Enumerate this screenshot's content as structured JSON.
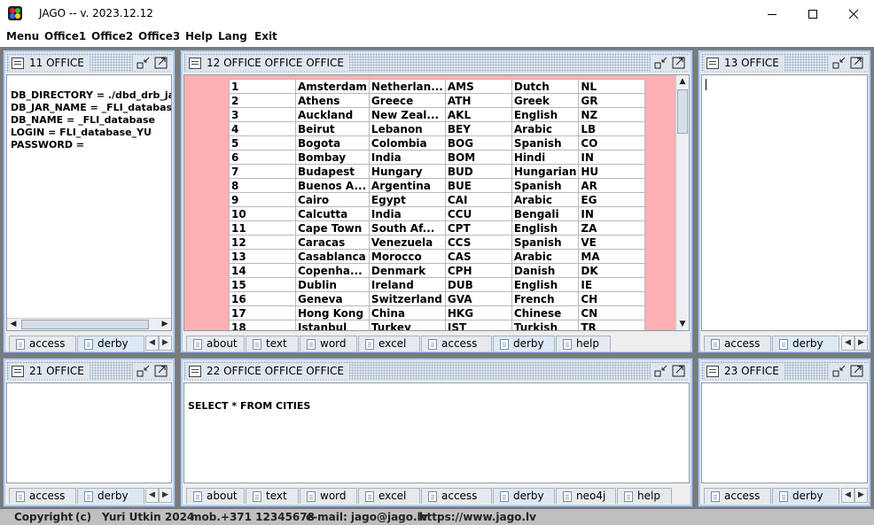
{
  "window": {
    "title": "JAGO -- v. 2023.12.12"
  },
  "menubar": [
    {
      "pre": "M",
      "u": "",
      "post": "enu",
      "label": "Menu"
    },
    {
      "label": "Office1"
    },
    {
      "label": "Office2"
    },
    {
      "label": "Office3"
    },
    {
      "label": "Help"
    },
    {
      "label": "Lang"
    },
    {
      "label": "Exit"
    }
  ],
  "frames": {
    "f11": {
      "title": "11 OFFICE",
      "text": "DB_DIRECTORY = ./dbd_drb_jar\nDB_JAR_NAME = _FLI_database\nDB_NAME = _FLI_database\nLOGIN = FLI_database_YU\nPASSWORD =",
      "tabs": [
        "access",
        "derby"
      ],
      "selected_tab": "derby"
    },
    "f12": {
      "title": "12 OFFICE OFFICE OFFICE",
      "tabs": [
        "about",
        "text",
        "word",
        "excel",
        "access",
        "derby",
        "help"
      ],
      "selected_tab": "derby",
      "rows": [
        [
          "1",
          "Amsterdam",
          "Netherlan...",
          "AMS",
          "Dutch",
          "NL"
        ],
        [
          "2",
          "Athens",
          "Greece",
          "ATH",
          "Greek",
          "GR"
        ],
        [
          "3",
          "Auckland",
          "New Zeal...",
          "AKL",
          "English",
          "NZ"
        ],
        [
          "4",
          "Beirut",
          "Lebanon",
          "BEY",
          "Arabic",
          "LB"
        ],
        [
          "5",
          "Bogota",
          "Colombia",
          "BOG",
          "Spanish",
          "CO"
        ],
        [
          "6",
          "Bombay",
          "India",
          "BOM",
          "Hindi",
          "IN"
        ],
        [
          "7",
          "Budapest",
          "Hungary",
          "BUD",
          "Hungarian",
          "HU"
        ],
        [
          "8",
          "Buenos A...",
          "Argentina",
          "BUE",
          "Spanish",
          "AR"
        ],
        [
          "9",
          "Cairo",
          "Egypt",
          "CAI",
          "Arabic",
          "EG"
        ],
        [
          "10",
          "Calcutta",
          "India",
          "CCU",
          "Bengali",
          "IN"
        ],
        [
          "11",
          "Cape Town",
          "South Af...",
          "CPT",
          "English",
          "ZA"
        ],
        [
          "12",
          "Caracas",
          "Venezuela",
          "CCS",
          "Spanish",
          "VE"
        ],
        [
          "13",
          "Casablanca",
          "Morocco",
          "CAS",
          "Arabic",
          "MA"
        ],
        [
          "14",
          "Copenha...",
          "Denmark",
          "CPH",
          "Danish",
          "DK"
        ],
        [
          "15",
          "Dublin",
          "Ireland",
          "DUB",
          "English",
          "IE"
        ],
        [
          "16",
          "Geneva",
          "Switzerland",
          "GVA",
          "French",
          "CH"
        ],
        [
          "17",
          "Hong Kong",
          "China",
          "HKG",
          "Chinese",
          "CN"
        ],
        [
          "18",
          "Istanbul",
          "Turkey",
          "IST",
          "Turkish",
          "TR"
        ]
      ]
    },
    "f13": {
      "title": "13 OFFICE",
      "tabs": [
        "access",
        "derby"
      ],
      "selected_tab": "derby"
    },
    "f21": {
      "title": "21 OFFICE",
      "tabs": [
        "access",
        "derby"
      ],
      "selected_tab": "derby"
    },
    "f22": {
      "title": "22 OFFICE OFFICE OFFICE",
      "sql": "SELECT * FROM CITIES",
      "tabs": [
        "about",
        "text",
        "word",
        "excel",
        "access",
        "derby",
        "neo4j",
        "help"
      ],
      "selected_tab": "derby"
    },
    "f23": {
      "title": "23 OFFICE",
      "tabs": [
        "access",
        "derby"
      ],
      "selected_tab": "derby"
    }
  },
  "status": {
    "copyright": "Copyright",
    "c": "(c)",
    "author": "Yuri Utkin 2024",
    "mob": "mob.+371 12345678",
    "email": "e-mail: jago@jago.lv",
    "url": "https://www.jago.lv"
  },
  "colors": {
    "desktop": "#7b7b7b",
    "grid_bg": "#ffb0b4",
    "frame_border": "#6a8bb9"
  },
  "icons": [
    "app-icon",
    "minimize-icon",
    "maximize-icon",
    "close-icon",
    "frame-menu-icon",
    "iconify-icon",
    "maximize-frame-icon",
    "document-icon",
    "arrow-left-icon",
    "arrow-right-icon",
    "arrow-up-icon",
    "arrow-down-icon"
  ]
}
